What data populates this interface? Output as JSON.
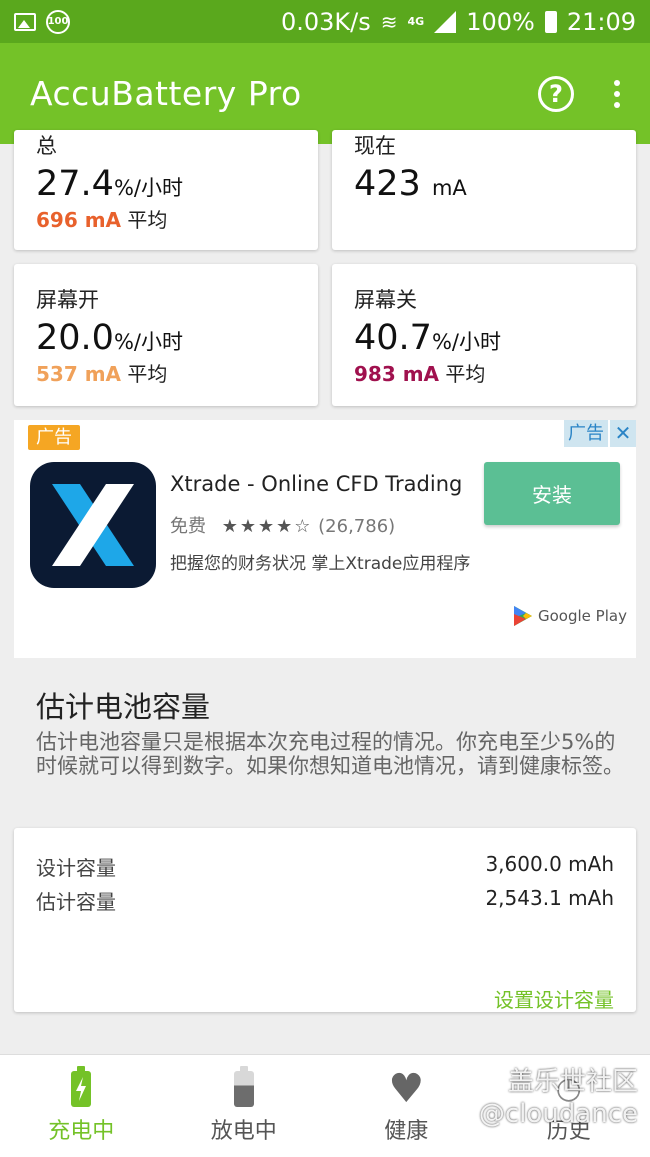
{
  "statusbar": {
    "badge": "100",
    "speed": "0.03K/s",
    "network": "4G",
    "battery": "100%",
    "time": "21:09"
  },
  "appbar": {
    "title": "AccuBattery Pro"
  },
  "cards": {
    "total": {
      "label": "总",
      "rate": "27.4",
      "rate_unit": "%/小时",
      "avg_value": "696 mA",
      "avg_label": "平均",
      "avg_color": "#e8612c"
    },
    "now": {
      "label": "现在",
      "value": "423",
      "unit": "mA"
    },
    "screen_on": {
      "label": "屏幕开",
      "rate": "20.0",
      "rate_unit": "%/小时",
      "avg_value": "537 mA",
      "avg_label": "平均",
      "avg_color": "#f0a15a"
    },
    "screen_off": {
      "label": "屏幕关",
      "rate": "40.7",
      "rate_unit": "%/小时",
      "avg_value": "983 mA",
      "avg_label": "平均",
      "avg_color": "#a0114e"
    }
  },
  "ad": {
    "tag": "广告",
    "corner_label": "广告",
    "title": "Xtrade - Online CFD Trading",
    "price": "免费",
    "rating": 4,
    "rating_max": 5,
    "reviews": "(26,786)",
    "description": "把握您的财务状况 掌上Xtrade应用程序",
    "install_label": "安装",
    "store": "Google Play"
  },
  "capacity": {
    "title": "估计电池容量",
    "description": "估计电池容量只是根据本次充电过程的情况。你充电至少5%的时候就可以得到数字。如果你想知道电池情况，请到健康标签。",
    "design_label": "设计容量",
    "design_value": "3,600.0 mAh",
    "estimated_label": "估计容量",
    "estimated_value": "2,543.1 mAh",
    "set_link": "设置设计容量"
  },
  "nav": {
    "charging": "充电中",
    "discharging": "放电中",
    "health": "健康",
    "history": "历史"
  },
  "watermark": {
    "line1": "盖乐世社区",
    "line2": "@cloudance"
  },
  "colors": {
    "accent": "#74c228",
    "statusbar": "#5aa81d",
    "install": "#5bbf94"
  }
}
